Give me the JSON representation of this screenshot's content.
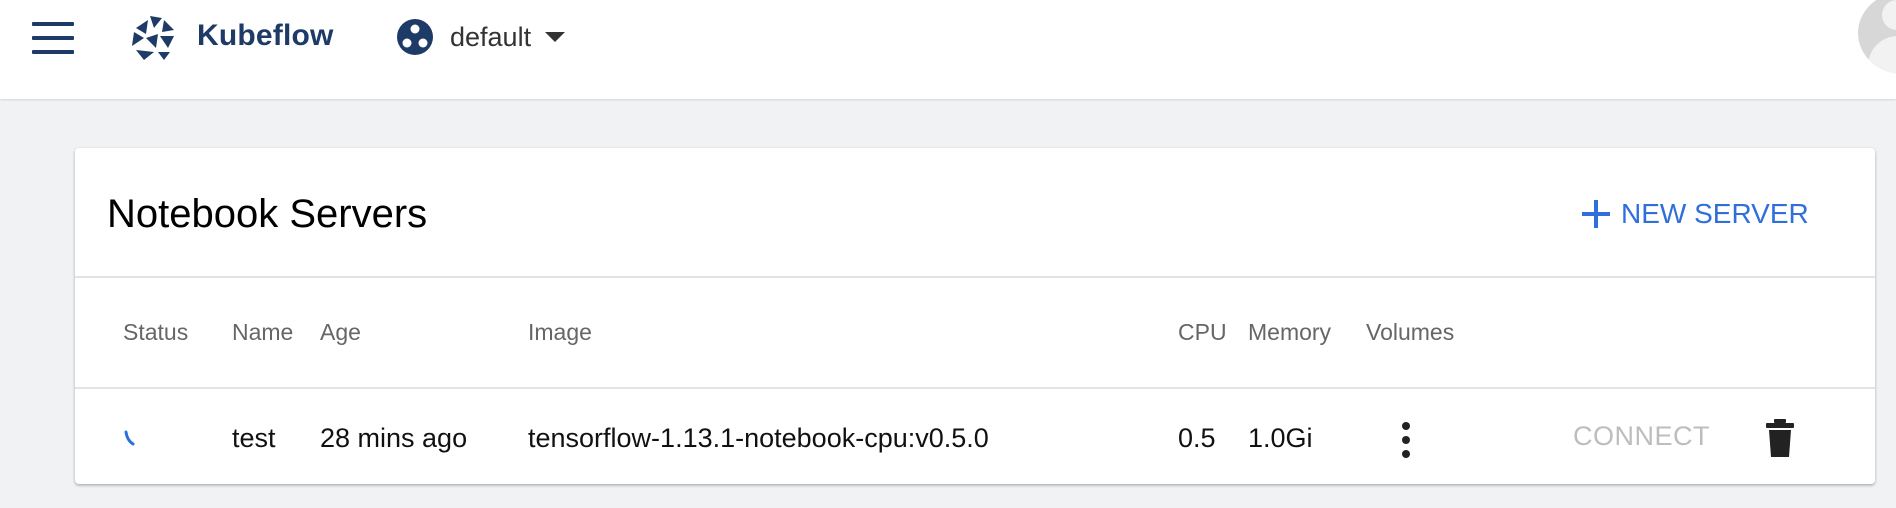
{
  "header": {
    "app_name": "Kubeflow",
    "namespace": "default",
    "menu_icon": "hamburger-menu-icon",
    "logo_icon": "kubeflow-logo-icon",
    "namespace_icon": "namespace-icon",
    "avatar_icon": "user-avatar-icon",
    "brand_color": "#1e3a66"
  },
  "card": {
    "title": "Notebook Servers",
    "new_server_label": "NEW SERVER",
    "new_server_icon": "plus-icon",
    "accent_color": "#2f6fdb"
  },
  "table": {
    "columns": [
      "Status",
      "Name",
      "Age",
      "Image",
      "CPU",
      "Memory",
      "Volumes"
    ],
    "rows": [
      {
        "status_icon": "loading-spinner-icon",
        "name": "test",
        "age": "28 mins ago",
        "image": "tensorflow-1.13.1-notebook-cpu:v0.5.0",
        "cpu": "0.5",
        "memory": "1.0Gi",
        "volumes_icon": "more-vert-icon",
        "connect_label": "CONNECT",
        "delete_icon": "delete-icon"
      }
    ]
  }
}
